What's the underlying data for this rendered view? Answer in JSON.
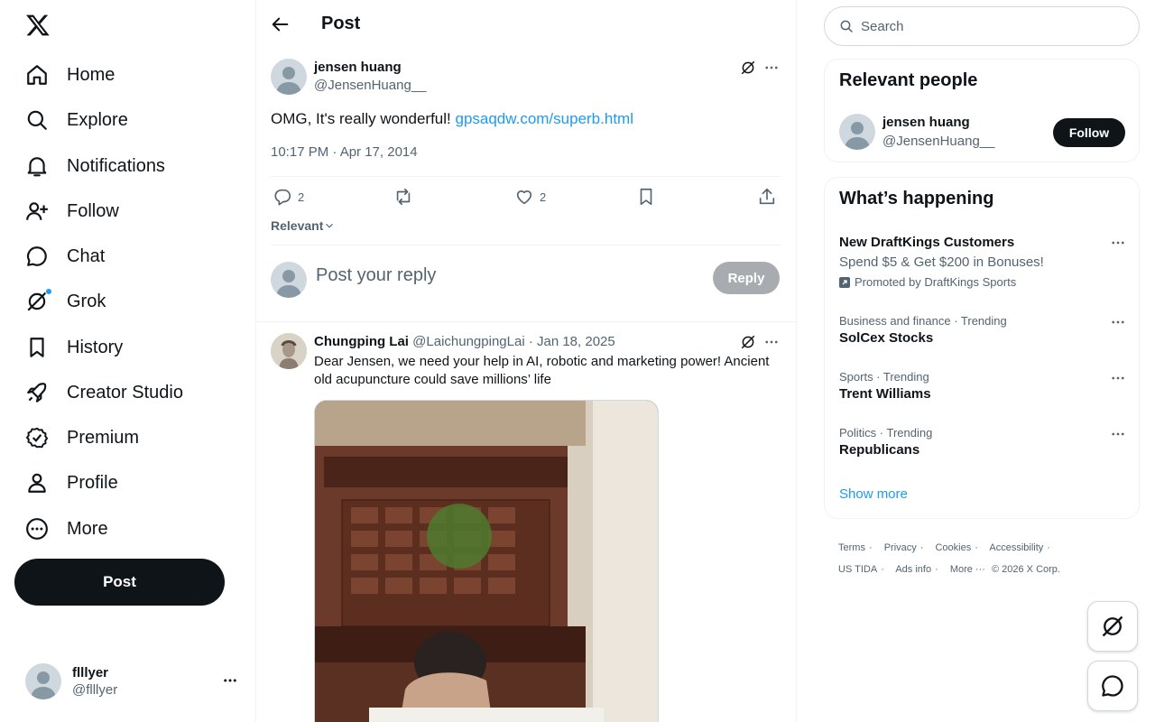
{
  "nav": {
    "logo_icon": "x-logo-icon",
    "items": [
      {
        "label": "Home",
        "icon": "home-icon"
      },
      {
        "label": "Explore",
        "icon": "search-icon"
      },
      {
        "label": "Notifications",
        "icon": "bell-icon"
      },
      {
        "label": "Follow",
        "icon": "person-plus-icon"
      },
      {
        "label": "Chat",
        "icon": "chat-bubble-icon"
      },
      {
        "label": "Grok",
        "icon": "grok-icon"
      },
      {
        "label": "History",
        "icon": "bookmark-icon"
      },
      {
        "label": "Creator Studio",
        "icon": "rocket-icon"
      },
      {
        "label": "Premium",
        "icon": "verified-badge-icon"
      },
      {
        "label": "Profile",
        "icon": "person-icon"
      },
      {
        "label": "More",
        "icon": "more-circle-icon"
      }
    ],
    "post_label": "Post",
    "account": {
      "name": "flllyer",
      "handle": "@flllyer"
    }
  },
  "main": {
    "title": "Post",
    "post": {
      "author_name": "jensen huang",
      "author_handle": "@JensenHuang__",
      "text": "OMG, It's really wonderful! ",
      "link": "gpsaqdw.com/superb.html",
      "timestamp": "10:17 PM · Apr 17, 2014",
      "replies": "2",
      "reposts": "",
      "likes": "2"
    },
    "sort_label": "Relevant",
    "reply_placeholder": "Post your reply",
    "reply_button": "Reply",
    "comment": {
      "author_name": "Chungping Lai",
      "author_handle": "@LaichungpingLai",
      "date": "· Jan 18, 2025",
      "text": "Dear Jensen, we need your help in AI, robotic and marketing power!  Ancient old acupuncture could save millions’ life"
    }
  },
  "right": {
    "search_placeholder": "Search",
    "relevant_people": {
      "title": "Relevant people",
      "name": "jensen huang",
      "handle": "@JensenHuang__",
      "follow_label": "Follow"
    },
    "happening": {
      "title": "What’s happening",
      "ad": {
        "title": "New DraftKings Customers",
        "subtitle": "Spend $5 & Get $200 in Bonuses!",
        "promoted": "Promoted by DraftKings Sports"
      },
      "trends": [
        {
          "category": "Business and finance · Trending",
          "title": "SolCex Stocks"
        },
        {
          "category": "Sports · Trending",
          "title": "Trent Williams"
        },
        {
          "category": "Politics · Trending",
          "title": "Republicans"
        }
      ],
      "show_more": "Show more"
    },
    "footer": {
      "links": [
        "Terms",
        "Privacy",
        "Cookies",
        "Accessibility",
        "US TIDA",
        "Ads info",
        "More ···",
        "© 2026 X Corp."
      ]
    }
  },
  "colors": {
    "accent": "#1d9bf0",
    "text": "#0f1419",
    "muted": "#536471",
    "border": "#eff3f4"
  }
}
